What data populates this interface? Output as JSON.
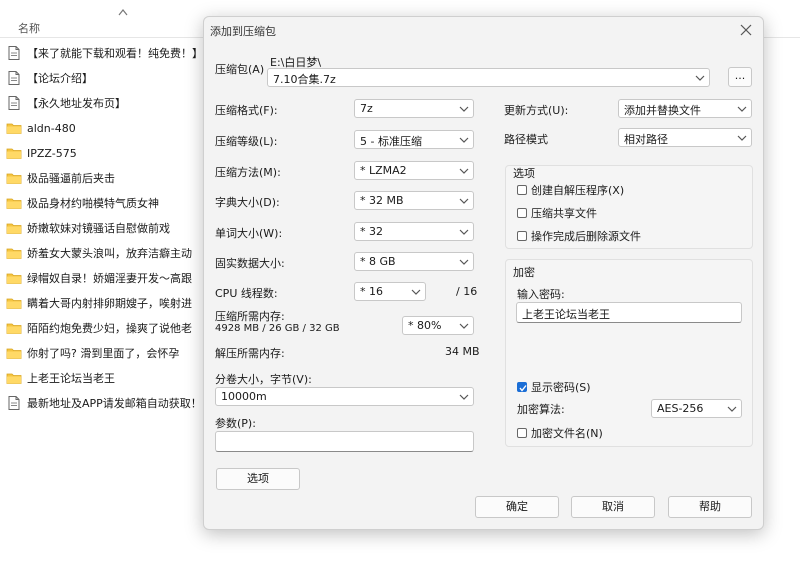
{
  "explorer": {
    "column_name": "名称",
    "files": [
      {
        "name": "【来了就能下载和观看！纯免费！】",
        "type": "file"
      },
      {
        "name": "【论坛介绍】",
        "type": "file"
      },
      {
        "name": "【永久地址发布页】",
        "type": "file"
      },
      {
        "name": "aldn-480",
        "type": "folder"
      },
      {
        "name": "IPZZ-575",
        "type": "folder"
      },
      {
        "name": "极品骚逼前后夹击",
        "type": "folder"
      },
      {
        "name": "极品身材约啪模特气质女神",
        "type": "folder"
      },
      {
        "name": "娇嫩软妹对镜骚话自慰做前戏",
        "type": "folder"
      },
      {
        "name": "娇羞女大蒙头浪叫，放弃洁癖主动",
        "type": "folder"
      },
      {
        "name": "绿帽奴自录！娇媚淫妻开发～高跟",
        "type": "folder"
      },
      {
        "name": "瞒着大哥内射排卵期嫂子，唉射进",
        "type": "folder"
      },
      {
        "name": "陌陌约炮免费少妇，操爽了说他老",
        "type": "folder"
      },
      {
        "name": "你射了吗? 滑到里面了，会怀孕",
        "type": "folder"
      },
      {
        "name": "上老王论坛当老王",
        "type": "folder"
      },
      {
        "name": "最新地址及APP请发邮箱自动获取！！",
        "type": "file"
      }
    ]
  },
  "dialog": {
    "title": "添加到压缩包",
    "archive_label": "压缩包(A)",
    "archive_path": "E:\\白日梦\\",
    "archive_name": "7.10合集.7z",
    "browse_label": "...",
    "format_label": "压缩格式(F):",
    "format_value": "7z",
    "level_label": "压缩等级(L):",
    "level_value": "5 - 标准压缩",
    "method_label": "压缩方法(M):",
    "method_value": "* LZMA2",
    "dict_label": "字典大小(D):",
    "dict_value": "* 32 MB",
    "word_label": "单词大小(W):",
    "word_value": "* 32",
    "solid_label": "固实数据大小:",
    "solid_value": "* 8 GB",
    "cpu_label": "CPU 线程数:",
    "cpu_value": "* 16",
    "cpu_max": "/ 16",
    "mem_comp_label": "压缩所需内存:",
    "mem_comp_detail": "4928 MB / 26 GB / 32 GB",
    "mem_comp_value": "* 80%",
    "mem_decomp_label": "解压所需内存:",
    "mem_decomp_value": "34 MB",
    "volume_label": "分卷大小，字节(V):",
    "volume_value": "10000m",
    "params_label": "参数(P):",
    "params_value": "",
    "options_button": "选项",
    "update_label": "更新方式(U):",
    "update_value": "添加并替换文件",
    "path_label": "路径模式",
    "path_value": "相对路径",
    "options_group": "选项",
    "opt_sfx": "创建自解压程序(X)",
    "opt_shared": "压缩共享文件",
    "opt_delete": "操作完成后删除源文件",
    "encrypt_group": "加密",
    "password_label": "输入密码:",
    "password_value": "上老王论坛当老王",
    "show_password": "显示密码(S)",
    "enc_method_label": "加密算法:",
    "enc_method_value": "AES-256",
    "enc_names": "加密文件名(N)",
    "ok": "确定",
    "cancel": "取消",
    "help": "帮助",
    "accent_color": "#1b6ed6"
  }
}
